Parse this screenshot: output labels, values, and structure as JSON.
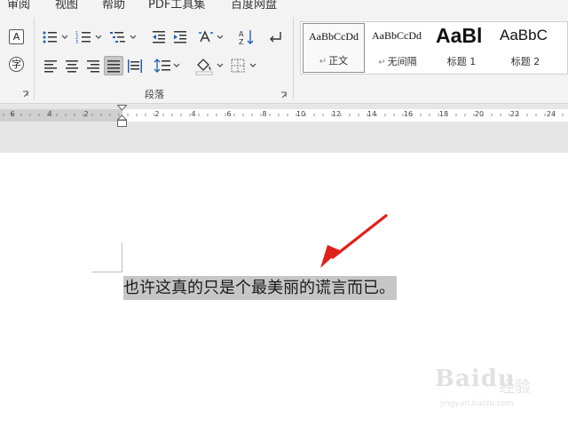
{
  "menu_tabs": [
    {
      "label": "审阅"
    },
    {
      "label": "视图"
    },
    {
      "label": "帮助"
    },
    {
      "label": "PDF工具集"
    },
    {
      "label": "百度网盘"
    }
  ],
  "ribbon": {
    "paragraph_group_label": "段落",
    "left_icons": [
      {
        "glyph": "A",
        "name": "character-border-icon"
      },
      {
        "glyph": "字",
        "name": "enclose-character-icon"
      }
    ]
  },
  "styles_gallery": {
    "items": [
      {
        "preview": "AaBbCcDd",
        "name": "正文",
        "mark": "↵",
        "active": true
      },
      {
        "preview": "AaBbCcDd",
        "name": "无间隔",
        "mark": "↵",
        "active": false
      },
      {
        "preview": "AaBl",
        "name": "标题 1",
        "mark": "",
        "active": false
      },
      {
        "preview": "AaBbC",
        "name": "标题 2",
        "mark": "",
        "active": false
      }
    ]
  },
  "ruler": {
    "labels": [
      {
        "text": "6",
        "pos": 14
      },
      {
        "text": "4",
        "pos": 56
      },
      {
        "text": "2",
        "pos": 97
      },
      {
        "text": "2",
        "pos": 177
      },
      {
        "text": "4",
        "pos": 218
      },
      {
        "text": "6",
        "pos": 258
      },
      {
        "text": "8",
        "pos": 298
      },
      {
        "text": "10",
        "pos": 339
      },
      {
        "text": "12",
        "pos": 379
      },
      {
        "text": "14",
        "pos": 419
      },
      {
        "text": "16",
        "pos": 460
      },
      {
        "text": "18",
        "pos": 500
      },
      {
        "text": "20",
        "pos": 540
      },
      {
        "text": "22",
        "pos": 580
      },
      {
        "text": "24",
        "pos": 621
      }
    ]
  },
  "document": {
    "selected_text": "也许这真的只是个最美丽的谎言而已。"
  },
  "watermark": {
    "logo": "Baidu",
    "suffix": "经验",
    "url": "jingyan.baidu.com"
  },
  "colors": {
    "ribbon_bg": "#f3f3f3",
    "selection": "#c6c6c6",
    "annotation_arrow": "#e0201b"
  }
}
